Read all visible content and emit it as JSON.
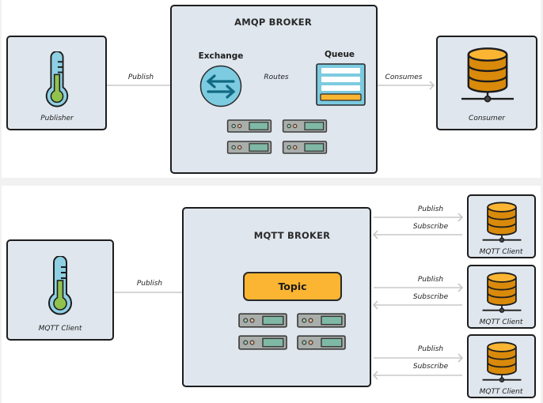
{
  "colors": {
    "box_fill": "#dfe6ee",
    "outline": "#1d1d1d",
    "arrow": "#c8c8c8",
    "thermo_blue": "#8ecfe3",
    "thermo_green": "#92c24e",
    "db_orange": "#d98a0a",
    "db_top": "#fbb532",
    "topic_fill": "#fbb532",
    "server_fill": "#a9aeaa",
    "server_screen": "#7fb9a5",
    "exchange_fill": "#7ccbe0",
    "exchange_arrows": "#116a82"
  },
  "amqp": {
    "broker_title": "AMQP BROKER",
    "publisher_label": "Publisher",
    "publish_arrow_label": "Publish",
    "exchange_label": "Exchange",
    "routes_arrow_label": "Routes",
    "queue_label": "Queue",
    "consumes_arrow_label": "Consumes",
    "consumer_label": "Consumer",
    "server_count": 4
  },
  "mqtt": {
    "broker_title": "MQTT BROKER",
    "left_client_label": "MQTT Client",
    "publish_arrow_label": "Publish",
    "topic_label": "Topic",
    "server_count": 4,
    "clients": [
      {
        "label": "MQTT Client",
        "publish_label": "Publish",
        "subscribe_label": "Subscribe"
      },
      {
        "label": "MQTT Client",
        "publish_label": "Publish",
        "subscribe_label": "Subscribe"
      },
      {
        "label": "MQTT Client",
        "publish_label": "Publish",
        "subscribe_label": "Subscribe"
      }
    ]
  },
  "icons": {
    "publisher": "thermometer-icon",
    "consumer": "database-icon",
    "exchange": "exchange-arrows-icon",
    "queue": "queue-icon",
    "server": "server-icon"
  }
}
